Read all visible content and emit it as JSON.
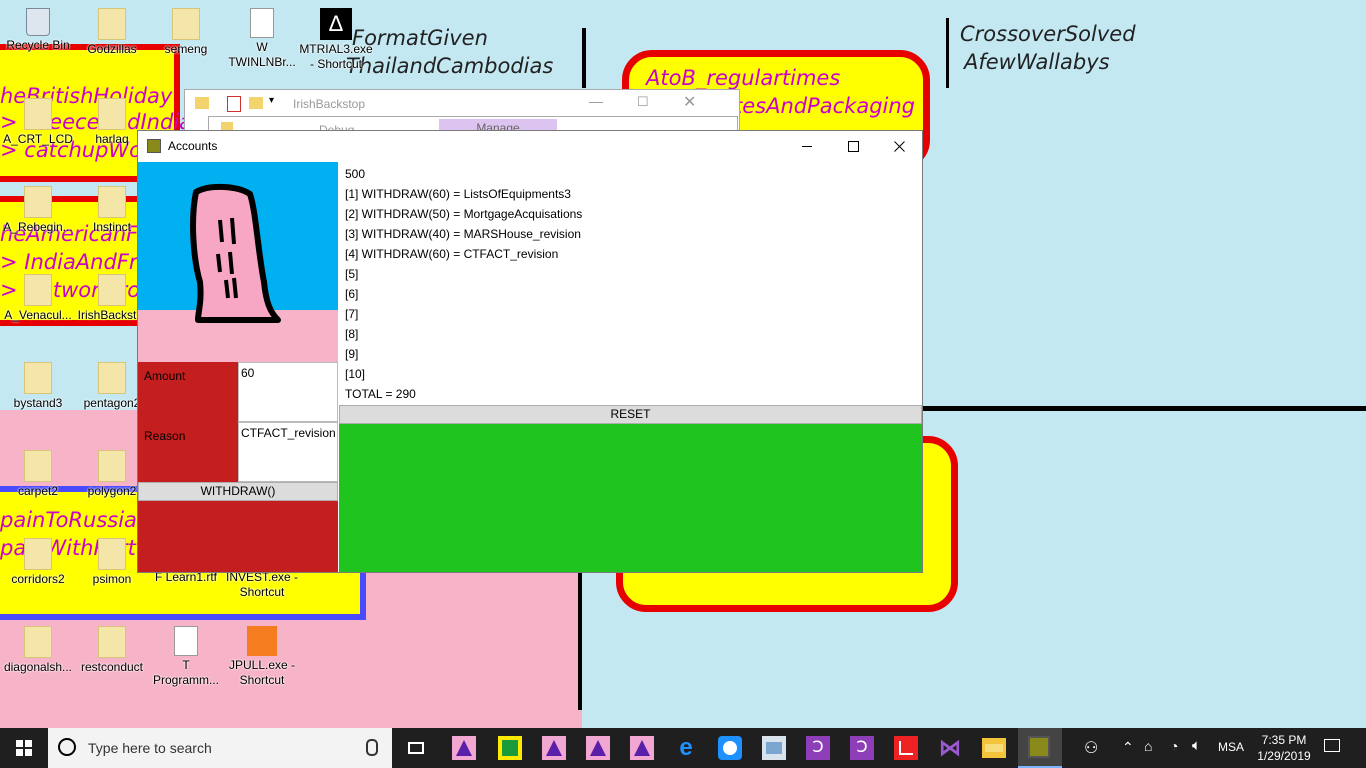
{
  "colors": {
    "wallpaper": "#c4e8f2",
    "pink": "#f7b3c7",
    "yellow": "#ffff00",
    "red": "#e60000",
    "purple_text": "#cc00cc",
    "green_panel": "#1fc41f",
    "dark_red_panel": "#c41e1e",
    "sky_blue": "#00b0f0",
    "taskbar": "#1f1f1f"
  },
  "wallpaper_text": {
    "format_given": "FormatGiven",
    "thailand": "ThailandCambodias",
    "crossover": "CrossoverSolved",
    "wallabys": "AfewWallabys",
    "atob": "AtoB_regulartimes",
    "packaging": "tesAndPackaging",
    "british": "heBritishHoliday",
    "greece": "> GreeceAndIndia",
    "catchup": "> catchupWork",
    "american": "heAmericanFrame",
    "india_france": "> IndiaAndFrance",
    "network": "> Network rol",
    "spain_russia": "painToRussia",
    "spain_portugal": "painWithPortugal"
  },
  "desktop_icons": [
    {
      "label": "Recycle Bin",
      "icon": "recycle-bin-icon"
    },
    {
      "label": "Godzillas",
      "icon": "folder-icon"
    },
    {
      "label": "semeng",
      "icon": "folder-icon"
    },
    {
      "label": "W TWINLNBr...",
      "icon": "document-icon"
    },
    {
      "label": "MTRIAL3.exe - Shortcut",
      "icon": "exe-shortcut-icon"
    },
    {
      "label": "A_CRT_LCD",
      "icon": "folder-icon"
    },
    {
      "label": "harlaq",
      "icon": "folder-icon"
    },
    {
      "label": "A_Rebegin...",
      "icon": "folder-icon"
    },
    {
      "label": "Instinct",
      "icon": "folder-icon"
    },
    {
      "label": "A_Venacul...",
      "icon": "folder-icon"
    },
    {
      "label": "IrishBackst...",
      "icon": "folder-icon"
    },
    {
      "label": "bystand3",
      "icon": "folder-icon"
    },
    {
      "label": "pentagon2",
      "icon": "folder-icon"
    },
    {
      "label": "carpet2",
      "icon": "folder-icon"
    },
    {
      "label": "polygon2",
      "icon": "folder-icon"
    },
    {
      "label": "corridors2",
      "icon": "folder-icon"
    },
    {
      "label": "psimon",
      "icon": "folder-icon"
    },
    {
      "label": "F Learn1.rtf",
      "icon": "document-icon"
    },
    {
      "label": "INVEST.exe - Shortcut",
      "icon": "exe-shortcut-icon"
    },
    {
      "label": "diagonalsh...",
      "icon": "folder-icon"
    },
    {
      "label": "restconduct",
      "icon": "folder-icon"
    },
    {
      "label": "T Programm...",
      "icon": "document-icon"
    },
    {
      "label": "JPULL.exe - Shortcut",
      "icon": "exe-shortcut-icon"
    }
  ],
  "bg_window_1": {
    "title": "IrishBackstop"
  },
  "bg_window_2": {
    "title": "Debug",
    "tab": "Manage"
  },
  "accounts_window": {
    "title": "Accounts",
    "amount_label": "Amount",
    "amount_value": "60",
    "reason_label": "Reason",
    "reason_value": "CTFACT_revision",
    "withdraw_button": "WITHDRAW()",
    "reset_button": "RESET",
    "history": [
      "500",
      "[1] WITHDRAW(60) = ListsOfEquipments3",
      "[2] WITHDRAW(50) = MortgageAcquisations",
      "[3] WITHDRAW(40) = MARSHouse_revision",
      "[4] WITHDRAW(60) = CTFACT_revision",
      "[5]",
      "[6]",
      "[7]",
      "[8]",
      "[9]",
      "[10]",
      "TOTAL = 290"
    ]
  },
  "taskbar": {
    "search_placeholder": "Type here to search",
    "language": "MSA",
    "time": "7:35 PM",
    "date": "1/29/2019",
    "apps": [
      "task-view-icon",
      "app-purple-icon",
      "app-green-map-icon",
      "app-purple-icon",
      "app-purple-icon",
      "app-purple-icon",
      "edge-icon",
      "chat-icon",
      "photo-icon",
      "onenote-icon",
      "onenote-icon",
      "acrobat-icon",
      "visual-studio-icon",
      "file-explorer-icon",
      "accounts-app-icon"
    ]
  }
}
